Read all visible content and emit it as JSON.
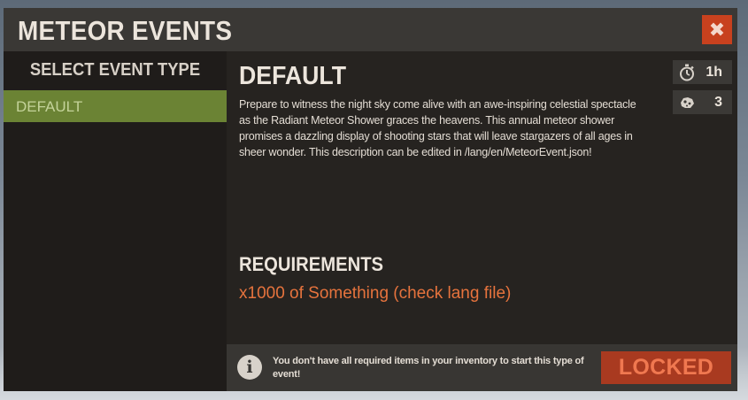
{
  "window": {
    "title": "METEOR EVENTS",
    "close_icon": "close-icon"
  },
  "sidebar": {
    "title": "SELECT EVENT TYPE",
    "items": [
      {
        "label": "DEFAULT",
        "selected": true
      }
    ]
  },
  "event": {
    "title": "DEFAULT",
    "description": "Prepare to witness the night sky come alive with an awe-inspiring celestial spectacle as the Radiant Meteor Shower graces the heavens. This annual meteor shower promises a dazzling display of shooting stars that will leave stargazers of all ages in sheer wonder. This description can be edited in /lang/en/MeteorEvent.json!",
    "stats": {
      "duration": {
        "icon": "stopwatch-icon",
        "value": "1h"
      },
      "count": {
        "icon": "meteor-icon",
        "value": "3"
      }
    },
    "requirements_title": "REQUIREMENTS",
    "requirements": [
      "x1000 of Something (check lang file)"
    ]
  },
  "footer": {
    "icon": "info-icon",
    "message": "You don't have all required items in your inventory to start this type of event!",
    "button_label": "LOCKED"
  },
  "colors": {
    "panel": "#262320",
    "titlebar": "#3a3835",
    "sidebar": "#1f1c1a",
    "selected": "#6b8334",
    "accent": "#c8411e",
    "requirement": "#e6733d",
    "locked": "#a93a20"
  }
}
